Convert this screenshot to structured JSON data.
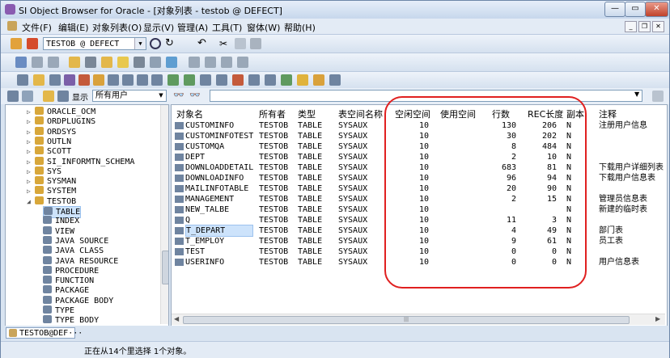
{
  "window": {
    "title": "SI Object Browser for Oracle - [对象列表 - testob @ DEFECT]"
  },
  "menu": [
    "文件(F)",
    "编辑(E)",
    "对象列表(O)",
    "显示(V)",
    "管理(A)",
    "工具(T)",
    "窗体(W)",
    "帮助(H)"
  ],
  "connection": {
    "value": "TESTOB @ DEFECT"
  },
  "filter": {
    "label": "显示",
    "owner": "所有用户"
  },
  "tree": [
    {
      "label": "ORACLE_OCM",
      "level": 0,
      "arrow": "▷"
    },
    {
      "label": "ORDPLUGINS",
      "level": 0,
      "arrow": "▷"
    },
    {
      "label": "ORDSYS",
      "level": 0,
      "arrow": "▷"
    },
    {
      "label": "OUTLN",
      "level": 0,
      "arrow": "▷"
    },
    {
      "label": "SCOTT",
      "level": 0,
      "arrow": "▷"
    },
    {
      "label": "SI_INFORMTN_SCHEMA",
      "level": 0,
      "arrow": "▷"
    },
    {
      "label": "SYS",
      "level": 0,
      "arrow": "▷"
    },
    {
      "label": "SYSMAN",
      "level": 0,
      "arrow": "▷"
    },
    {
      "label": "SYSTEM",
      "level": 0,
      "arrow": "▷"
    },
    {
      "label": "TESTOB",
      "level": 0,
      "arrow": "◢"
    },
    {
      "label": "TABLE",
      "level": 1,
      "arrow": ""
    },
    {
      "label": "INDEX",
      "level": 1,
      "arrow": ""
    },
    {
      "label": "VIEW",
      "level": 1,
      "arrow": ""
    },
    {
      "label": "JAVA SOURCE",
      "level": 1,
      "arrow": ""
    },
    {
      "label": "JAVA CLASS",
      "level": 1,
      "arrow": ""
    },
    {
      "label": "JAVA RESOURCE",
      "level": 1,
      "arrow": ""
    },
    {
      "label": "PROCEDURE",
      "level": 1,
      "arrow": ""
    },
    {
      "label": "FUNCTION",
      "level": 1,
      "arrow": ""
    },
    {
      "label": "PACKAGE",
      "level": 1,
      "arrow": ""
    },
    {
      "label": "PACKAGE BODY",
      "level": 1,
      "arrow": ""
    },
    {
      "label": "TYPE",
      "level": 1,
      "arrow": ""
    },
    {
      "label": "TYPE BODY",
      "level": 1,
      "arrow": ""
    }
  ],
  "tree_selected": "TABLE",
  "columns": [
    "对象名",
    "所有者",
    "类型",
    "表空间名称",
    "空闲空间",
    "使用空间",
    "行数",
    "REC长度",
    "副本",
    "注释"
  ],
  "rows": [
    [
      "CUSTOMINFO",
      "TESTOB",
      "TABLE",
      "SYSAUX",
      "10",
      "",
      "130",
      "206",
      "N",
      "注册用户信息"
    ],
    [
      "CUSTOMINFOTEST",
      "TESTOB",
      "TABLE",
      "SYSAUX",
      "10",
      "",
      "30",
      "202",
      "N",
      ""
    ],
    [
      "CUSTOMQA",
      "TESTOB",
      "TABLE",
      "SYSAUX",
      "10",
      "",
      "8",
      "484",
      "N",
      ""
    ],
    [
      "DEPT",
      "TESTOB",
      "TABLE",
      "SYSAUX",
      "10",
      "",
      "2",
      "10",
      "N",
      ""
    ],
    [
      "DOWNLOADDETAIL",
      "TESTOB",
      "TABLE",
      "SYSAUX",
      "10",
      "",
      "683",
      "81",
      "N",
      "下载用户详细列表"
    ],
    [
      "DOWNLOADINFO",
      "TESTOB",
      "TABLE",
      "SYSAUX",
      "10",
      "",
      "96",
      "94",
      "N",
      "下载用户信息表"
    ],
    [
      "MAILINFOTABLE",
      "TESTOB",
      "TABLE",
      "SYSAUX",
      "10",
      "",
      "20",
      "90",
      "N",
      ""
    ],
    [
      "MANAGEMENT",
      "TESTOB",
      "TABLE",
      "SYSAUX",
      "10",
      "",
      "2",
      "15",
      "N",
      "管理员信息表"
    ],
    [
      "NEW_TALBE",
      "TESTOB",
      "TABLE",
      "SYSAUX",
      "10",
      "",
      "",
      "",
      "N",
      "新建的临时表"
    ],
    [
      "Q",
      "TESTOB",
      "TABLE",
      "SYSAUX",
      "10",
      "",
      "11",
      "3",
      "N",
      ""
    ],
    [
      "T_DEPART",
      "TESTOB",
      "TABLE",
      "SYSAUX",
      "10",
      "",
      "4",
      "49",
      "N",
      "部门表"
    ],
    [
      "T_EMPLOY",
      "TESTOB",
      "TABLE",
      "SYSAUX",
      "10",
      "",
      "9",
      "61",
      "N",
      "员工表"
    ],
    [
      "TEST",
      "TESTOB",
      "TABLE",
      "SYSAUX",
      "10",
      "",
      "0",
      "0",
      "N",
      ""
    ],
    [
      "USERINFO",
      "TESTOB",
      "TABLE",
      "SYSAUX",
      "10",
      "",
      "0",
      "0",
      "N",
      "用户信息表"
    ]
  ],
  "selected_row": "T_DEPART",
  "doc_tab": "TESTOB@DEF···",
  "status": "正在从14个里选择 1个对象。",
  "colors": {
    "highlight": "#e02020",
    "selection": "#cde3fb"
  }
}
